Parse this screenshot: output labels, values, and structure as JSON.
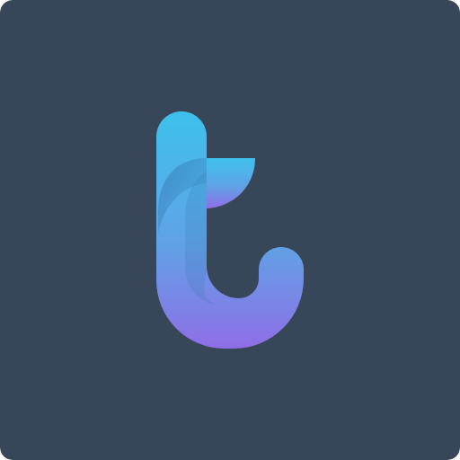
{
  "icon": {
    "name": "t-letter-logo-icon",
    "colors": {
      "background": "#384659",
      "gradient_top": "#3EC1EC",
      "gradient_mid": "#5FA3E6",
      "gradient_bottom": "#8F6EE6",
      "fold_shadow": "#2F6FA8"
    }
  }
}
